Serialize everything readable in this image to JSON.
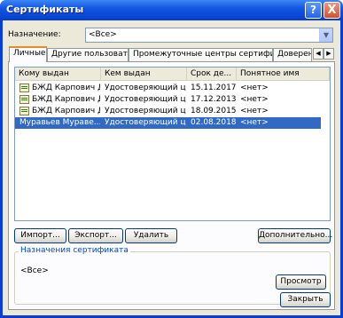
{
  "window": {
    "title": "Сертификаты",
    "help_glyph": "?",
    "close_glyph": "X"
  },
  "purpose": {
    "label": "Назначение:",
    "value": "<Все>"
  },
  "tabs": [
    "Личные",
    "Другие пользователи",
    "Промежуточные центры сертификации",
    "Доверенн"
  ],
  "columns": [
    "Кому выдан",
    "Кем выдан",
    "Срок де...",
    "Понятное имя"
  ],
  "rows": [
    {
      "issued_to": "БЖД Карпович Д.А.",
      "issued_by": "Удостоверяющий це...",
      "expires": "15.11.2017",
      "friendly": "<нет>",
      "selected": false
    },
    {
      "issued_to": "БЖД Карпович Д.А.",
      "issued_by": "Удостоверяющий це...",
      "expires": "17.12.2013",
      "friendly": "<нет>",
      "selected": false
    },
    {
      "issued_to": "БЖД Карпович Д.А.",
      "issued_by": "Удостоверяющий це...",
      "expires": "18.09.2015",
      "friendly": "<нет>",
      "selected": false
    },
    {
      "issued_to": "Муравьев Мураве...",
      "issued_by": "Удостоверяющий це...",
      "expires": "02.08.2018",
      "friendly": "<нет>",
      "selected": true
    }
  ],
  "buttons": {
    "import": "Импорт...",
    "export": "Экспорт...",
    "delete": "Удалить",
    "advanced": "Дополнительно...",
    "view": "Просмотр",
    "close": "Закрыть"
  },
  "purposes_group": {
    "title": "Назначения сертификата",
    "value": "<Все>"
  },
  "colors": {
    "title_bar": "#0a46d6",
    "selection": "#316ac5",
    "dialog_bg": "#ece9d8",
    "tab_highlight": "#e68b2c"
  }
}
